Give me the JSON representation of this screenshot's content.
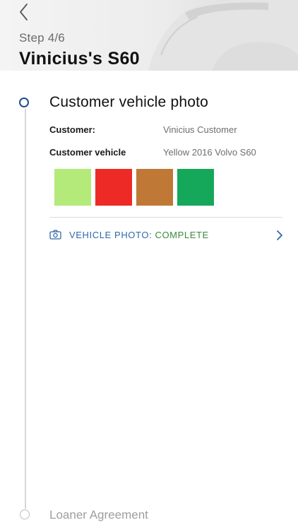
{
  "header": {
    "step": "Step 4/6",
    "title": "Vinicius's S60"
  },
  "current_step": {
    "title": "Customer vehicle photo",
    "rows": [
      {
        "label": "Customer:",
        "value": "Vinicius Customer"
      },
      {
        "label": "Customer vehicle",
        "value": "Yellow 2016 Volvo S60"
      }
    ],
    "swatches": [
      "#b3ea7a",
      "#ee2a26",
      "#c07836",
      "#16a85a"
    ],
    "photo_status": {
      "label": "VEHICLE PHOTO: ",
      "value": "COMPLETE"
    }
  },
  "next_step": {
    "title": "Loaner Agreement"
  },
  "colors": {
    "accent": "#1e4f8a",
    "link": "#2f68a8",
    "complete": "#3b8a3b"
  },
  "icons": [
    "back-chevron-icon",
    "camera-icon",
    "chevron-right-icon"
  ]
}
